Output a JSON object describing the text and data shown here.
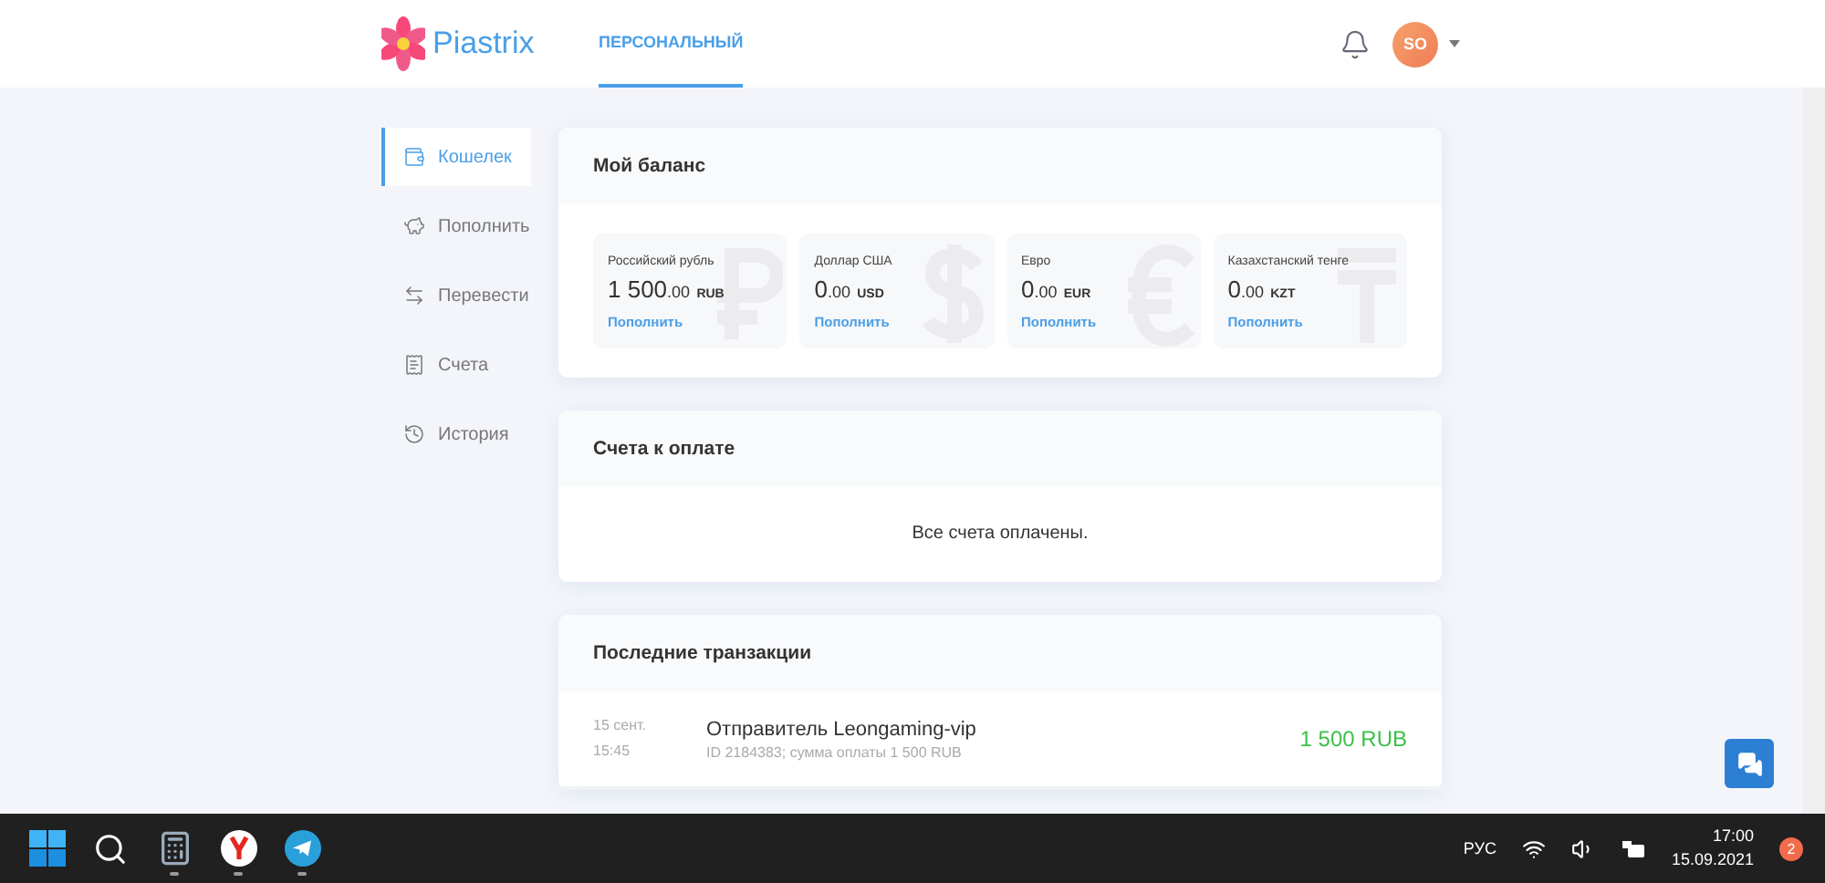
{
  "header": {
    "logo": "Piastrix",
    "tabs": [
      {
        "label": "ПЕРСОНАЛЬНЫЙ",
        "selected": true
      }
    ],
    "avatar": "SO"
  },
  "sidebar": {
    "items": [
      {
        "label": "Кошелек",
        "selected": true
      },
      {
        "label": "Пополнить",
        "selected": false
      },
      {
        "label": "Перевести",
        "selected": false
      },
      {
        "label": "Счета",
        "selected": false
      },
      {
        "label": "История",
        "selected": false
      }
    ]
  },
  "balance": {
    "title": "Мой баланс",
    "currencies": [
      {
        "name": "Российский рубль",
        "whole": "1 500",
        "cents": ".00",
        "code": "RUB",
        "action": "Пополнить"
      },
      {
        "name": "Доллар США",
        "whole": "0",
        "cents": ".00",
        "code": "USD",
        "action": "Пополнить"
      },
      {
        "name": "Евро",
        "whole": "0",
        "cents": ".00",
        "code": "EUR",
        "action": "Пополнить"
      },
      {
        "name": "Казахстанский тенге",
        "whole": "0",
        "cents": ".00",
        "code": "KZT",
        "action": "Пополнить"
      }
    ]
  },
  "invoices": {
    "title": "Счета к оплате",
    "message": "Все счета оплачены."
  },
  "transactions": {
    "title": "Последние транзакции",
    "rows": [
      {
        "date": "15 сент.",
        "time": "15:45",
        "title": "Отправитель Leongaming-vip",
        "details": "ID 2184383; сумма оплаты 1 500 RUB",
        "amount": "1 500 RUB"
      }
    ]
  },
  "taskbar": {
    "apps": [
      {
        "kind": "start"
      },
      {
        "kind": "search"
      },
      {
        "kind": "calculator",
        "running": true
      },
      {
        "kind": "browser",
        "running": true
      },
      {
        "kind": "telegram",
        "running": true
      }
    ],
    "language": "РУС",
    "time": "17:00",
    "date": "15.09.2021",
    "notifications": "2"
  }
}
